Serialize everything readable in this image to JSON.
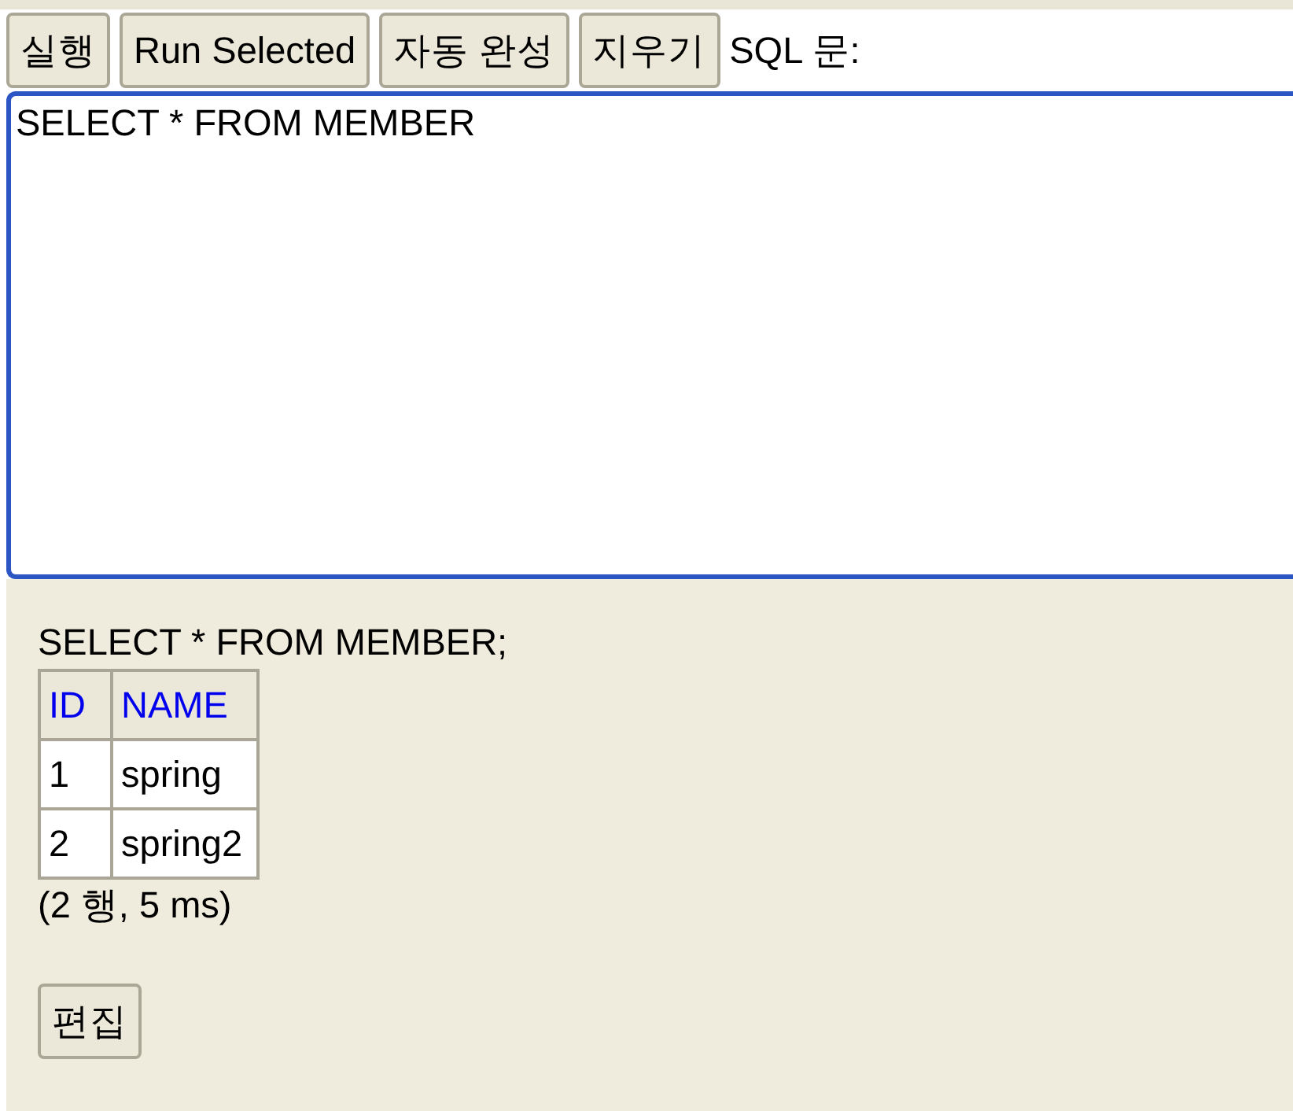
{
  "toolbar": {
    "buttons": [
      "실행",
      "Run Selected",
      "자동 완성",
      "지우기"
    ],
    "label": "SQL 문:"
  },
  "editor": {
    "value": "SELECT * FROM MEMBER",
    "focused": true
  },
  "result": {
    "statement": "SELECT * FROM MEMBER;",
    "table": {
      "columns": [
        "ID",
        "NAME"
      ],
      "rows": [
        [
          "1",
          "spring"
        ],
        [
          "2",
          "spring2"
        ]
      ]
    },
    "summary": "(2 행, 5 ms)",
    "buttons": [
      "편집"
    ]
  }
}
